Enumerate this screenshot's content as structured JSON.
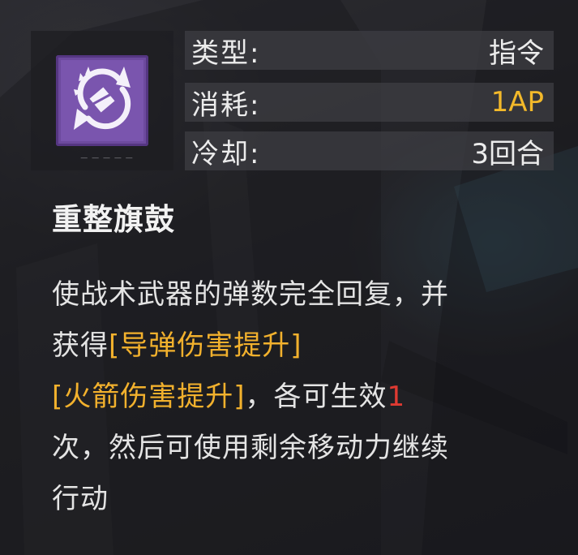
{
  "colors": {
    "accent": "#f3b92a",
    "highlight": "#f2b12d",
    "number": "#e03a32",
    "icon_tile": "#6d4a9e"
  },
  "skill": {
    "icon": "shield-arrow-icon",
    "name": "重整旗鼓",
    "stats": [
      {
        "label": "类型:",
        "value": "指令"
      },
      {
        "label": "消耗:",
        "value": "1AP"
      },
      {
        "label": "冷却:",
        "value": "3回合"
      }
    ],
    "description": {
      "l1": "使战术武器的弹数完全回复，并",
      "l2a": "获得",
      "l2b": "[导弹伤害提升]",
      "l3a": "[火箭伤害提升]",
      "l3b": "，各可生效",
      "l3c": "1",
      "l4": "次，然后可使用剩余移动力继续",
      "l5": "行动"
    }
  }
}
